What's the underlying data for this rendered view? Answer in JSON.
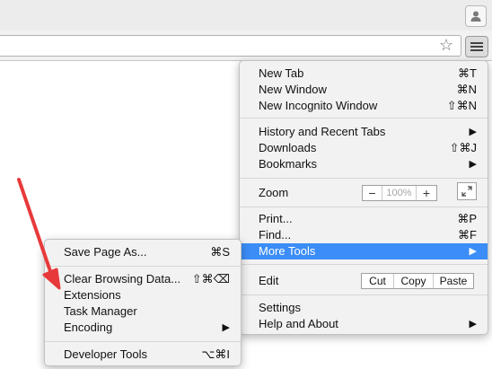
{
  "main_menu": {
    "new_tab": {
      "label": "New Tab",
      "shortcut": "⌘T"
    },
    "new_window": {
      "label": "New Window",
      "shortcut": "⌘N"
    },
    "new_incognito": {
      "label": "New Incognito Window",
      "shortcut": "⇧⌘N"
    },
    "history": {
      "label": "History and Recent Tabs",
      "arrow": "▶"
    },
    "downloads": {
      "label": "Downloads",
      "shortcut": "⇧⌘J"
    },
    "bookmarks": {
      "label": "Bookmarks",
      "arrow": "▶"
    },
    "zoom": {
      "label": "Zoom",
      "minus": "−",
      "value": "100%",
      "plus": "+"
    },
    "print": {
      "label": "Print...",
      "shortcut": "⌘P"
    },
    "find": {
      "label": "Find...",
      "shortcut": "⌘F"
    },
    "more_tools": {
      "label": "More Tools",
      "arrow": "▶"
    },
    "edit": {
      "label": "Edit",
      "cut": "Cut",
      "copy": "Copy",
      "paste": "Paste"
    },
    "settings": {
      "label": "Settings"
    },
    "help": {
      "label": "Help and About",
      "arrow": "▶"
    }
  },
  "sub_menu": {
    "save_page": {
      "label": "Save Page As...",
      "shortcut": "⌘S"
    },
    "clear_data": {
      "label": "Clear Browsing Data...",
      "shortcut": "⇧⌘⌫"
    },
    "extensions": {
      "label": "Extensions"
    },
    "task_manager": {
      "label": "Task Manager"
    },
    "encoding": {
      "label": "Encoding",
      "arrow": "▶"
    },
    "dev_tools": {
      "label": "Developer Tools",
      "shortcut": "⌥⌘I"
    }
  },
  "toolbar": {
    "star": "☆"
  },
  "colors": {
    "highlight": "#3b8df7",
    "annotation_arrow": "#e8393a"
  },
  "icons": [
    "profile-icon",
    "star-icon",
    "hamburger-menu-icon",
    "fullscreen-icon",
    "annotation-arrow"
  ]
}
